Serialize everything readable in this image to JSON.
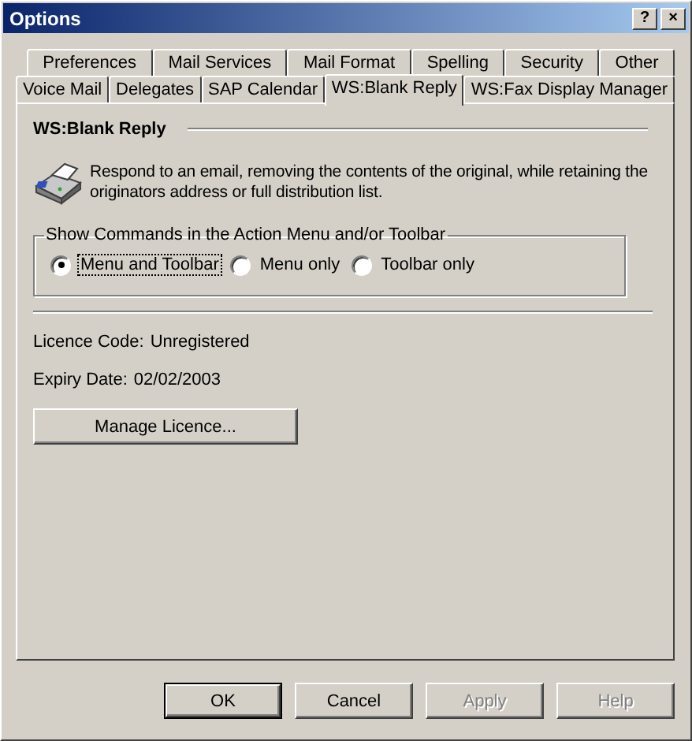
{
  "window": {
    "title": "Options",
    "controls": [
      "?",
      "×"
    ]
  },
  "tab_rows": [
    [
      {
        "label": "Preferences",
        "selected": false
      },
      {
        "label": "Mail Services",
        "selected": false
      },
      {
        "label": "Mail Format",
        "selected": false
      },
      {
        "label": "Spelling",
        "selected": false
      },
      {
        "label": "Security",
        "selected": false
      },
      {
        "label": "Other",
        "selected": false
      }
    ],
    [
      {
        "label": "Voice Mail",
        "selected": false
      },
      {
        "label": "Delegates",
        "selected": false
      },
      {
        "label": "SAP Calendar",
        "selected": false
      },
      {
        "label": "WS:Blank Reply",
        "selected": true
      },
      {
        "label": "WS:Fax Display Manager",
        "selected": false
      }
    ]
  ],
  "page": {
    "heading": "WS:Blank Reply",
    "description": "Respond to an email, removing the contents of the original, while retaining the originators address or full distribution list.",
    "group": {
      "title": "Show Commands in the Action Menu and/or Toolbar",
      "options": [
        {
          "label": "Menu and Toolbar",
          "selected": true
        },
        {
          "label": "Menu only",
          "selected": false
        },
        {
          "label": "Toolbar only",
          "selected": false
        }
      ]
    },
    "fields": [
      {
        "label": "Licence Code:",
        "value": "Unregistered"
      },
      {
        "label": "Expiry Date:",
        "value": "02/02/2003"
      }
    ],
    "button": "Manage Licence..."
  },
  "buttons": [
    {
      "label": "OK",
      "default": true,
      "disabled": false
    },
    {
      "label": "Cancel",
      "default": false,
      "disabled": false
    },
    {
      "label": "Apply",
      "default": false,
      "disabled": true
    },
    {
      "label": "Help",
      "default": false,
      "disabled": true
    }
  ]
}
